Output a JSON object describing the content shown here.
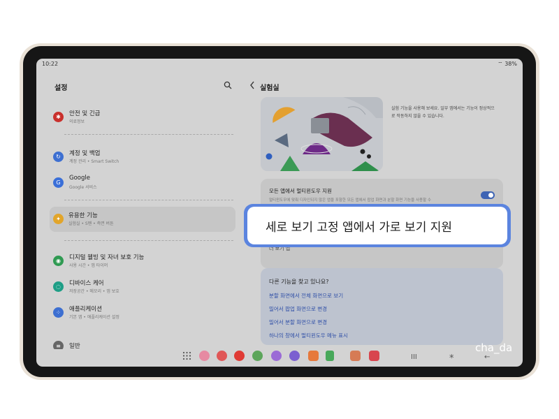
{
  "status": {
    "time": "10:22",
    "battery": "38%"
  },
  "settings": {
    "title": "설정",
    "items": [
      {
        "title": "안전 및 긴급",
        "subtitle": "의료정보",
        "icon": "safety-icon",
        "color": "#c9302c"
      },
      {
        "title": "계정 및 백업",
        "subtitle": "계정 관리 • Smart Switch",
        "icon": "sync-icon",
        "color": "#3d6fd1"
      },
      {
        "title": "Google",
        "subtitle": "Google 서비스",
        "icon": "google-icon",
        "color": "#3a6fd8"
      },
      {
        "title": "유용한 기능",
        "subtitle": "실험실 • S펜 • 측면 버튼",
        "icon": "star-icon",
        "color": "#e2a52a"
      },
      {
        "title": "디지털 웰빙 및 자녀 보호 기능",
        "subtitle": "사용 시간 • 앱 타이머",
        "icon": "wellbeing-icon",
        "color": "#2f9a52"
      },
      {
        "title": "디바이스 케어",
        "subtitle": "저장공간 • 메모리 • 앱 보호",
        "icon": "device-care-icon",
        "color": "#1e9e86"
      },
      {
        "title": "애플리케이션",
        "subtitle": "기본 앱 • 애플리케이션 설정",
        "icon": "apps-icon",
        "color": "#3d6fd1"
      },
      {
        "title": "일반",
        "subtitle": "",
        "icon": "general-icon",
        "color": "#666666"
      }
    ]
  },
  "lab": {
    "title": "실험실",
    "description": "실험 기능을 사용해 보세요. 일부 앱에서는 기능이 정상적으로 작동하지 않을 수 있습니다.",
    "multiwindow_title": "모든 앱에서 멀티윈도우 지원",
    "multiwindow_desc": "멀티윈도우에 맞춰 디자인되지 않은 앱을 포함한 모든 앱에서 팝업 화면과 분할 화면 기능을 사용할 수",
    "toggle_on": "true",
    "row3": "더 보기 앱",
    "more_question": "다른 기능을 찾고 있나요?",
    "links": [
      "분할 화면에서 전체 화면으로 보기",
      "밀어서 팝업 화면으로 변경",
      "밀어서 분할 화면으로 변경",
      "하나의 창에서 멀티윈도우 메뉴 표시"
    ]
  },
  "callout": {
    "text": "세로 보기 고정 앱에서 가로 보기 지원"
  },
  "taskbar": {
    "apps": [
      {
        "name": "app-grid-icon",
        "color": "#555555"
      },
      {
        "name": "pink-app-icon",
        "color": "#e68aa2"
      },
      {
        "name": "red-app-icon",
        "color": "#e05757"
      },
      {
        "name": "youtube-icon",
        "color": "#e03b35"
      },
      {
        "name": "chrome-icon",
        "color": "#5ca55a"
      },
      {
        "name": "purple-app-icon",
        "color": "#9b6bd6"
      },
      {
        "name": "violet-app-icon",
        "color": "#7b5fd0"
      },
      {
        "name": "orange-app-icon",
        "color": "#e6793c"
      },
      {
        "name": "green-app-icon",
        "color": "#48a85a"
      },
      {
        "name": "photo-app-icon",
        "color": "#d67b55"
      },
      {
        "name": "gallery-app-icon",
        "color": "#d8454e"
      }
    ],
    "nav_recent": "III",
    "nav_home": "*",
    "nav_back": "←"
  },
  "watermark": "cha_da"
}
